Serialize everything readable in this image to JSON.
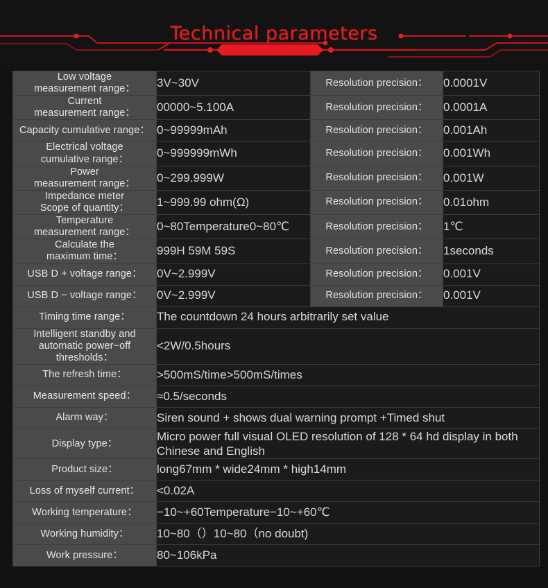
{
  "header": {
    "title": "Technical parameters",
    "accent_color": "#e02020",
    "background_color": "#131313"
  },
  "table": {
    "label_bg": "#4a4a4a",
    "value_bg": "#1b1b1b",
    "border_color": "#3d3d3d",
    "resolution_label": "Resolution precision：",
    "split_rows": [
      {
        "label": "Low voltage\nmeasurement range：",
        "value": "3V~30V",
        "res_label": "Resolution precision：",
        "res_value": "0.0001V"
      },
      {
        "label": "Current\nmeasurement range：",
        "value": "00000~5.100A",
        "res_label": "Resolution precision：",
        "res_value": "0.0001A"
      },
      {
        "label": "Capacity cumulative range：",
        "value": "0~99999mAh",
        "res_label": "Resolution precision：",
        "res_value": "0.001Ah"
      },
      {
        "label": "Electrical voltage\ncumulative range：",
        "value": "0~999999mWh",
        "res_label": "Resolution precision：",
        "res_value": "0.001Wh"
      },
      {
        "label": "Power\nmeasurement range：",
        "value": "0~299.999W",
        "res_label": "Resolution precision：",
        "res_value": "0.001W"
      },
      {
        "label": "Impedance meter\nScope of quantity：",
        "value": "1~999.99 ohm(Ω)",
        "res_label": "Resolution precision：",
        "res_value": "0.01ohm"
      },
      {
        "label": "Temperature\nmeasurement range：",
        "value": "0~80Temperature0~80℃",
        "res_label": "Resolution precision：",
        "res_value": "1℃"
      },
      {
        "label": "Calculate the\nmaximum time：",
        "value": "999H  59M  59S",
        "res_label": "Resolution precision：",
        "res_value": "1seconds"
      },
      {
        "label": "USB  D + voltage range：",
        "value": "0V~2.999V",
        "res_label": "Resolution precision：",
        "res_value": "0.001V"
      },
      {
        "label": "USB  D − voltage range：",
        "value": "0V~2.999V",
        "res_label": "Resolution precision：",
        "res_value": "0.001V"
      }
    ],
    "full_rows": [
      {
        "label": "Timing time range：",
        "value": "The countdown 24 hours arbitrarily set value",
        "size": "normal"
      },
      {
        "label": "Intelligent standby and\nautomatic power−off\nthresholds：",
        "value": "<2W/0.5hours",
        "size": "normal"
      },
      {
        "label": "The refresh time：",
        "value": ">500mS/time>500mS/times",
        "size": "normal"
      },
      {
        "label": "Measurement speed：",
        "value": "≈0.5/seconds",
        "size": "normal"
      },
      {
        "label": "Alarm way：",
        "value": "Siren sound + shows dual warning prompt  +Timed shut",
        "size": "normal"
      },
      {
        "label": "Display type：",
        "value": "Micro power full visual OLED resolution of 128 * 64 hd display in both Chinese and English",
        "size": "small"
      },
      {
        "label": "Product size：",
        "value": "long67mm * wide24mm * high14mm",
        "size": "normal"
      },
      {
        "label": "Loss of myself current：",
        "value": "<0.02A",
        "size": "normal"
      },
      {
        "label": "Working temperature：",
        "value": "−10~+60Temperature−10~+60℃",
        "size": "normal"
      },
      {
        "label": "Working humidity：",
        "value": "10~80（）10~80（no doubt)",
        "size": "normal"
      },
      {
        "label": "Work pressure：",
        "value": "80~106kPa",
        "size": "normal"
      }
    ]
  }
}
